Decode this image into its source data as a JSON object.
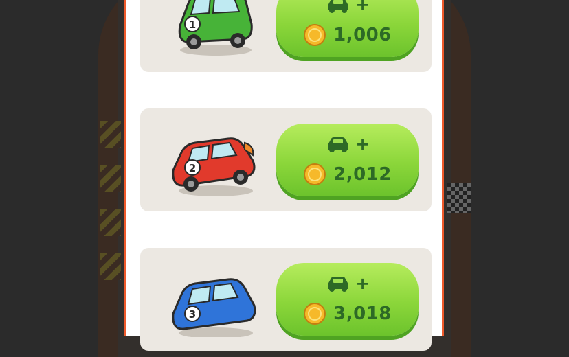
{
  "cards": [
    {
      "car_number": "1",
      "car_color": "#47b338",
      "car_icon": "green-car-icon",
      "action": "+",
      "price": "1,006"
    },
    {
      "car_number": "2",
      "car_color": "#e13a2c",
      "car_icon": "red-car-icon",
      "action": "+",
      "price": "2,012"
    },
    {
      "car_number": "3",
      "car_color": "#2f74d9",
      "car_icon": "blue-car-icon",
      "action": "+",
      "price": "3,018"
    }
  ],
  "colors": {
    "button_green": "#8bd63a",
    "button_text": "#2d6a26",
    "coin_gold": "#f6b92a",
    "panel_border": "#ef5a2b"
  }
}
